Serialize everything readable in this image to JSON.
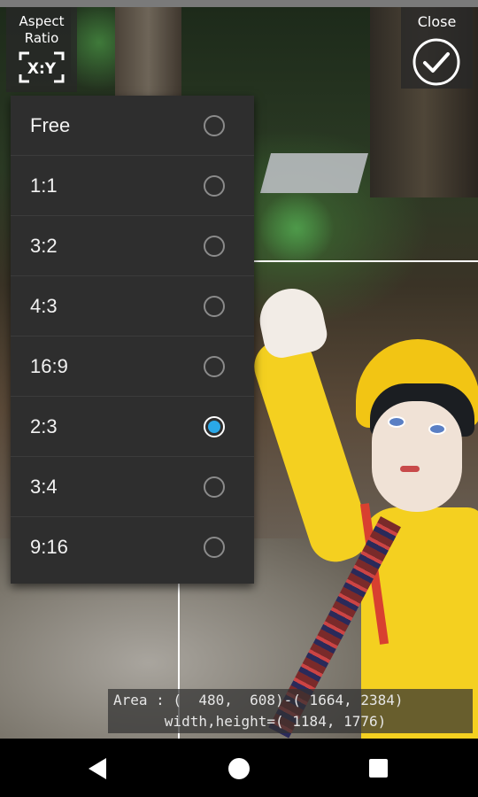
{
  "toolbar": {
    "aspect_label": "Aspect\nRatio",
    "aspect_icon_text": "X:Y",
    "close_label": "Close"
  },
  "aspect_menu": {
    "options": [
      {
        "label": "Free",
        "selected": false
      },
      {
        "label": "1:1",
        "selected": false
      },
      {
        "label": "3:2",
        "selected": false
      },
      {
        "label": "4:3",
        "selected": false
      },
      {
        "label": "16:9",
        "selected": false
      },
      {
        "label": "2:3",
        "selected": true
      },
      {
        "label": "3:4",
        "selected": false
      },
      {
        "label": "9:16",
        "selected": false
      }
    ]
  },
  "crop_info": {
    "line1": "Area : (  480,  608)-( 1664, 2384)",
    "line2": "      width,height=( 1184, 1776)"
  },
  "colors": {
    "radio_selected": "#2aa8e8",
    "menu_bg": "#2e2e2e"
  },
  "navigation": {
    "icons": [
      "back-icon",
      "home-icon",
      "recent-apps-icon"
    ]
  }
}
